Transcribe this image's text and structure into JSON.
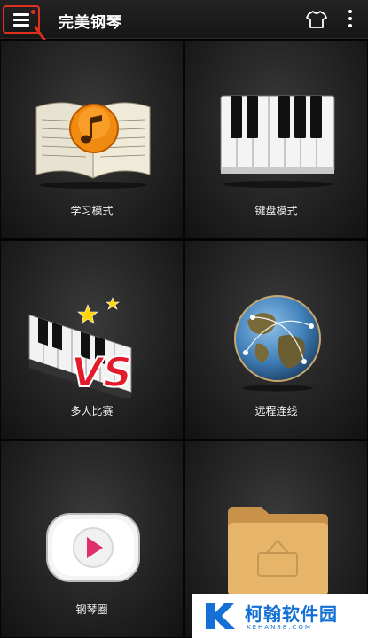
{
  "header": {
    "title": "完美钢琴",
    "menu_icon": "hamburger-menu-icon",
    "theme_icon": "tshirt-icon",
    "more_icon": "more-vertical-icon"
  },
  "tiles": [
    {
      "label": "学习模式",
      "icon": "songbook-music-icon"
    },
    {
      "label": "键盘模式",
      "icon": "piano-keyboard-icon"
    },
    {
      "label": "多人比赛",
      "icon": "piano-vs-icon"
    },
    {
      "label": "远程连线",
      "icon": "globe-network-icon"
    },
    {
      "label": "钢琴圈",
      "icon": "play-circle-icon"
    },
    {
      "label": "",
      "icon": "folder-icon"
    }
  ],
  "watermark": {
    "text": "柯翰软件园",
    "sub": "KEHAN88.COM"
  },
  "colors": {
    "accent_red": "#e0301e",
    "watermark_blue": "#1470d6"
  }
}
